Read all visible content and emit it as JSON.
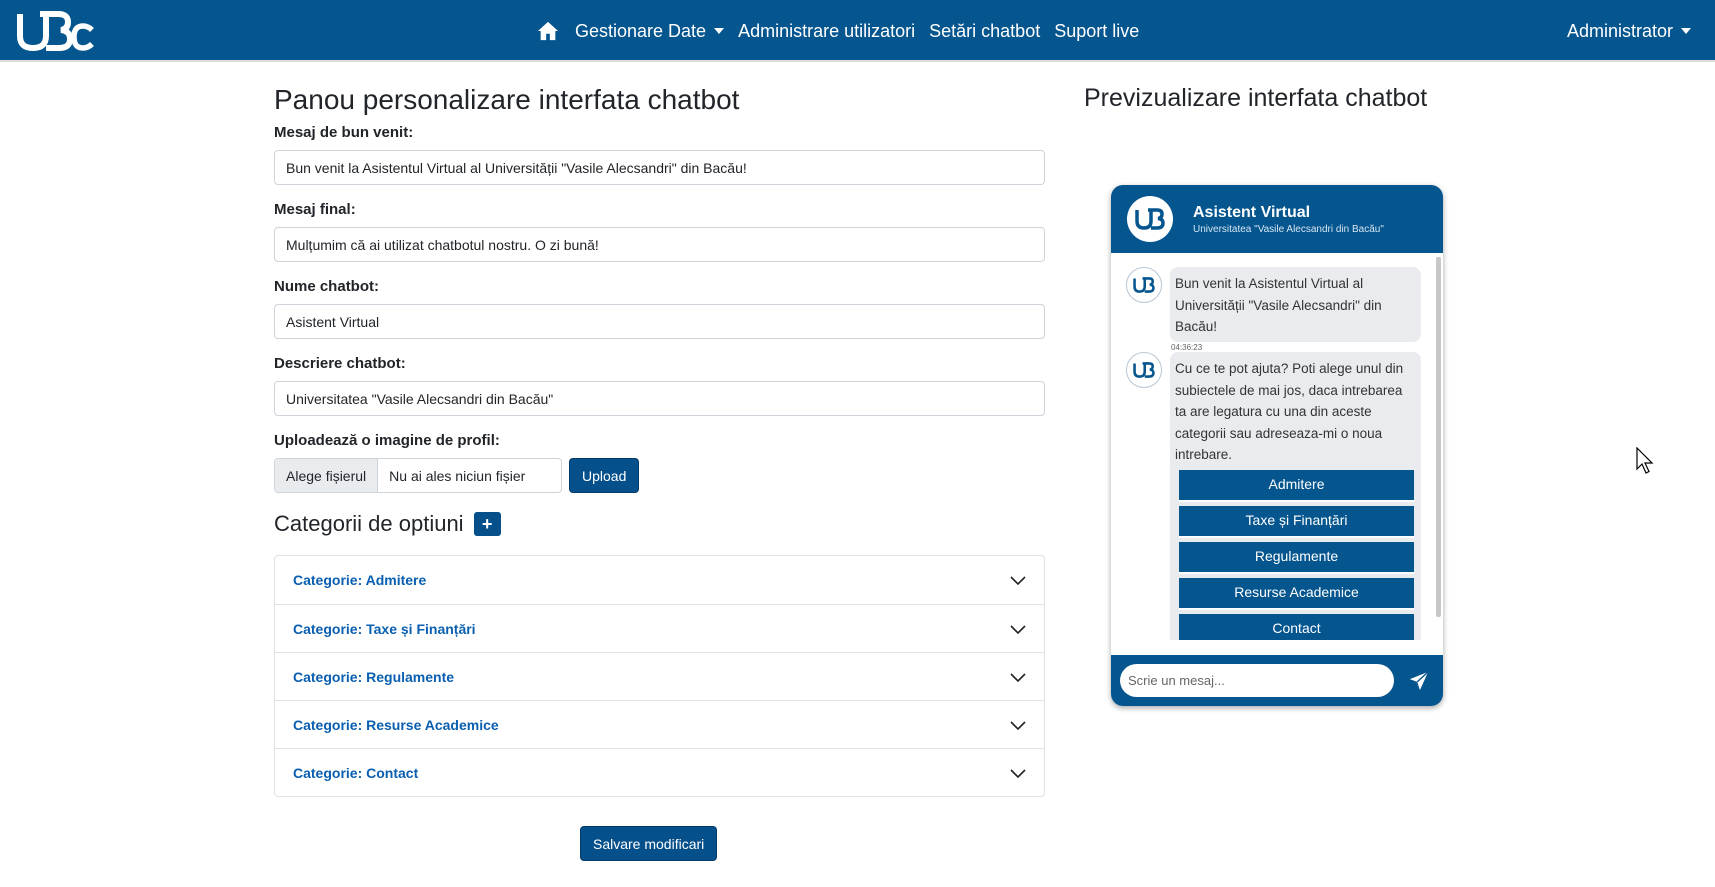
{
  "navbar": {
    "logo_text": "UBc",
    "items": [
      {
        "label": "Gestionare Date",
        "dropdown": true
      },
      {
        "label": "Administrare utilizatori"
      },
      {
        "label": "Setări chatbot"
      },
      {
        "label": "Suport live"
      }
    ],
    "user_menu": "Administrator"
  },
  "panel": {
    "title": "Panou personalizare interfata chatbot",
    "welcome_label": "Mesaj de bun venit:",
    "welcome_value": "Bun venit la Asistentul Virtual al Universității \"Vasile Alecsandri\" din Bacău!",
    "final_label": "Mesaj final:",
    "final_value": "Mulțumim că ai utilizat chatbotul nostru. O zi bună!",
    "name_label": "Nume chatbot:",
    "name_value": "Asistent Virtual",
    "desc_label": "Descriere chatbot:",
    "desc_value": "Universitatea \"Vasile Alecsandri din Bacău\"",
    "upload_label": "Uploadează o imagine de profil:",
    "file_button": "Alege fișierul",
    "file_none": "Nu ai ales niciun fișier",
    "upload_button": "Upload",
    "categories_title": "Categorii de optiuni",
    "add_symbol": "+",
    "categories": [
      "Categorie: Admitere",
      "Categorie: Taxe și Finanțări",
      "Categorie: Regulamente",
      "Categorie: Resurse Academice",
      "Categorie: Contact"
    ],
    "save_button": "Salvare modificari"
  },
  "preview": {
    "title": "Previzualizare interfata chatbot",
    "bot_name": "Asistent Virtual",
    "bot_desc": "Universitatea \"Vasile Alecsandri din Bacău\"",
    "msg1": "Bun venit la Asistentul Virtual al Universității \"Vasile Alecsandri\" din Bacău!",
    "msg1_time": "04:36:23",
    "msg2": "Cu ce te pot ajuta? Poti alege unul din subiectele de mai jos, daca intrebarea ta are legatura cu una din aceste categorii sau adreseaza-mi o noua intrebare.",
    "options": [
      "Admitere",
      "Taxe și Finanțări",
      "Regulamente",
      "Resurse Academice",
      "Contact"
    ],
    "input_placeholder": "Scrie un mesaj..."
  },
  "colors": {
    "brand": "#05558f",
    "button": "#05508a",
    "link": "#0a5fb0"
  },
  "icons": [
    "home-icon",
    "caret-down-icon",
    "chevron-down-icon",
    "send-icon",
    "cursor-icon"
  ]
}
